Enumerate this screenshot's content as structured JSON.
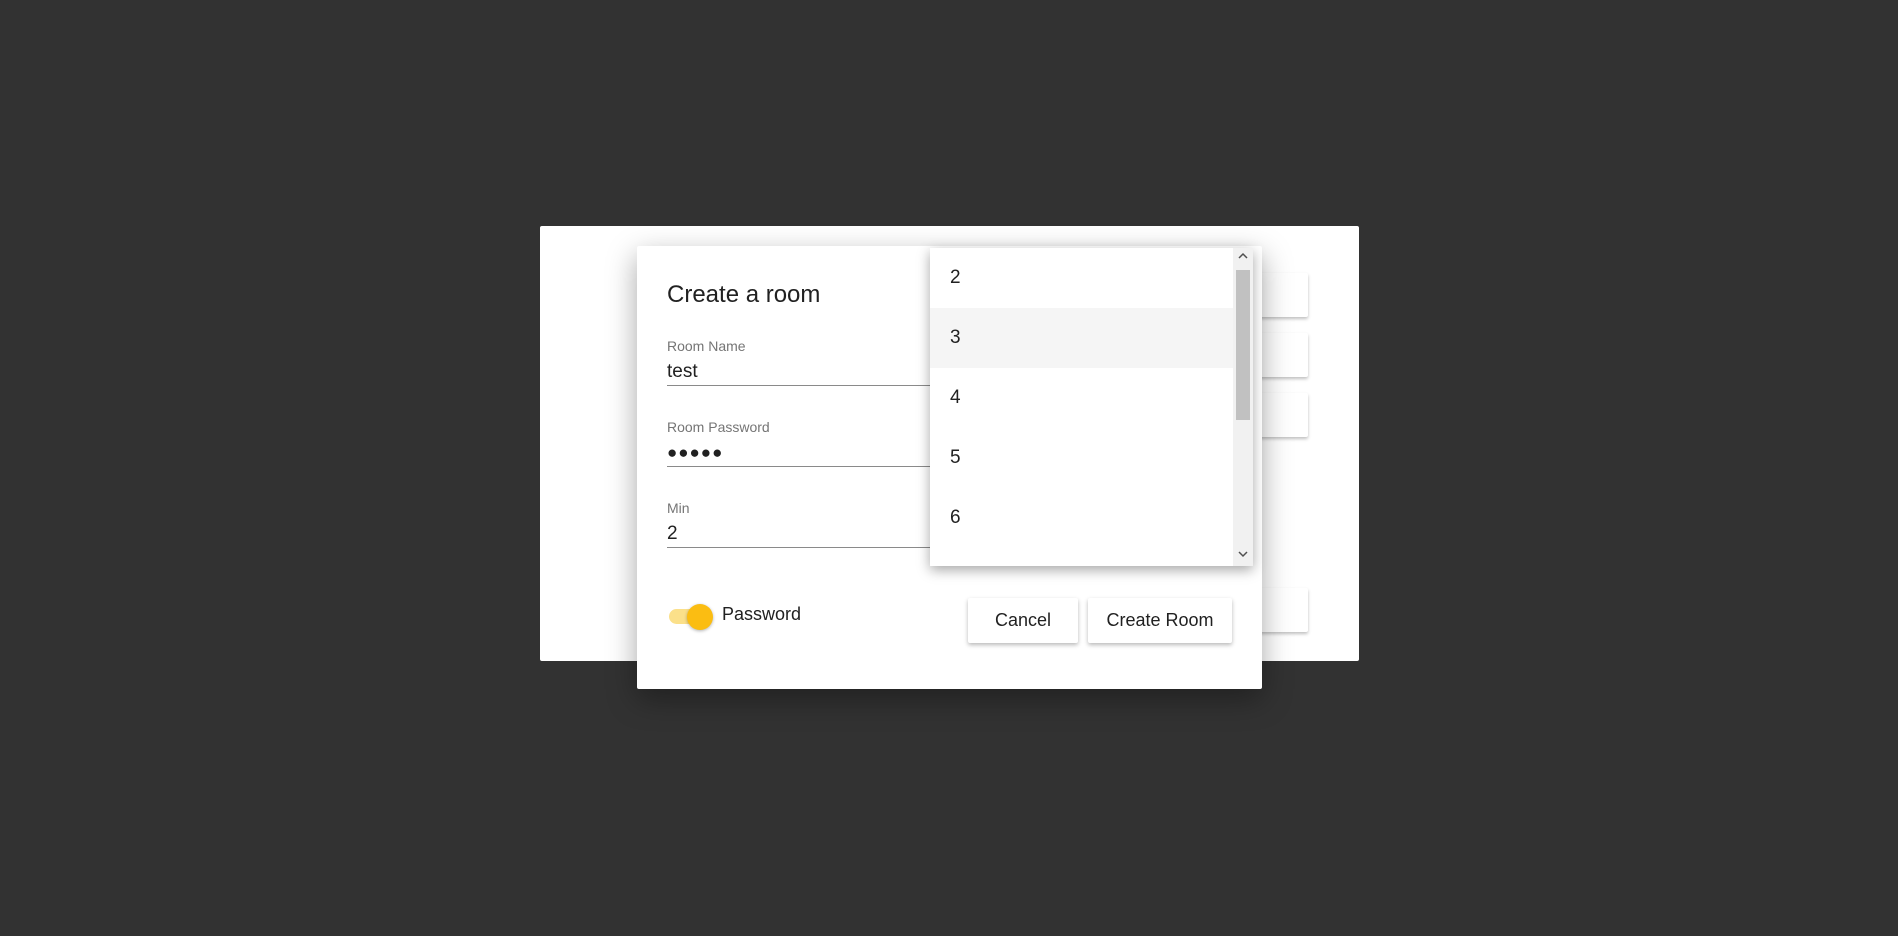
{
  "dialog": {
    "title": "Create a room",
    "fields": {
      "room_name": {
        "label": "Room Name",
        "value": "test"
      },
      "room_password": {
        "label": "Room Password",
        "value": "●●●●●"
      },
      "min": {
        "label": "Min",
        "value": "2"
      }
    },
    "toggle": {
      "label": "Password",
      "checked": true
    },
    "buttons": {
      "cancel": "Cancel",
      "create": "Create Room"
    }
  },
  "dropdown": {
    "options": [
      "2",
      "3",
      "4",
      "5",
      "6"
    ],
    "highlighted": "3"
  },
  "colors": {
    "backdrop": "#323232",
    "toggle_thumb": "#fbbd12",
    "toggle_track": "#fbe08a"
  },
  "icons": {
    "scroll_up": "chevron-up-icon",
    "scroll_down": "chevron-down-icon"
  }
}
